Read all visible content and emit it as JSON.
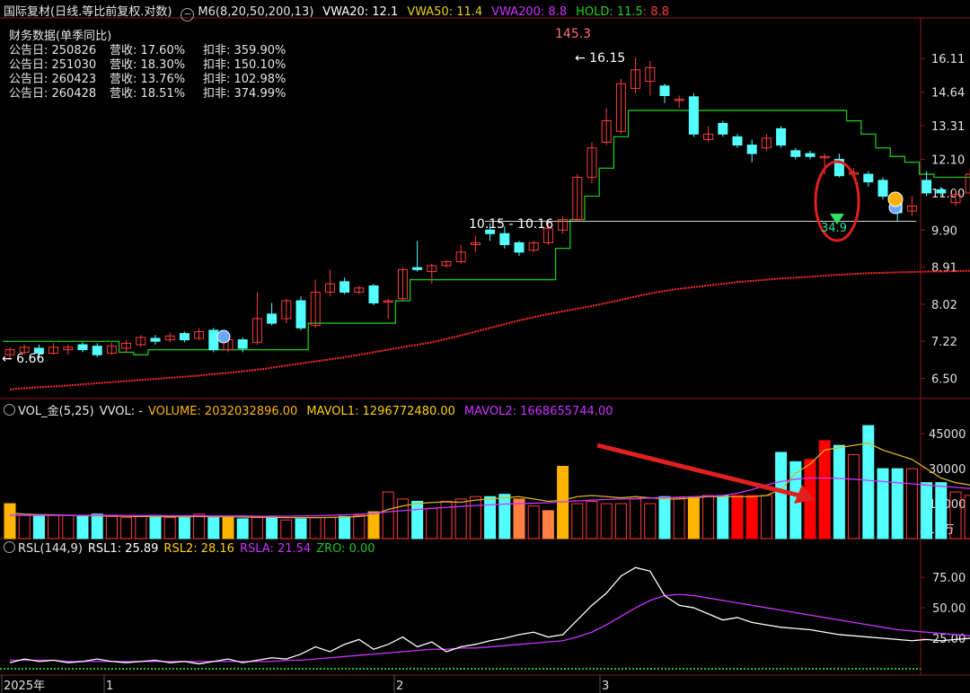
{
  "header": {
    "title": "国际复材(日线.等比前复权.对数)",
    "indicator_icon": "circle-minus-icon",
    "m6": "M6(8,20,50,200,13)",
    "vwa20": "VWA20: 12.1",
    "vwa50": "VWA50: 11.4",
    "vwa200": "VWA200: 8.8",
    "hold": "HOLD: 11.5",
    "hold2": ": 8.8"
  },
  "finance": {
    "title": "财务数据(单季同比)",
    "rows": [
      {
        "date": "公告日: 250826",
        "rev": "营收: 17.60%",
        "profit": "扣非: 359.90%"
      },
      {
        "date": "公告日: 251030",
        "rev": "营收: 18.30%",
        "profit": "扣非: 150.10%"
      },
      {
        "date": "公告日: 260423",
        "rev": "营收: 13.76%",
        "profit": "扣非: 102.98%"
      },
      {
        "date": "公告日: 260428",
        "rev": "营收: 18.51%",
        "profit": "扣非: 374.99%"
      }
    ]
  },
  "vol_header": {
    "name": "VOL_金(5,25)",
    "vvol": "VVOL: -",
    "volume": "VOLUME: 2032032896.00",
    "mavol1": "MAVOL1: 1296772480.00",
    "mavol2": "MAVOL2: 1668655744.00"
  },
  "rsl_header": {
    "name": "RSL(144,9)",
    "rsl1": "RSL1: 25.89",
    "rsl2": "RSL2: 28.16",
    "rsla": "RSLA: 21.54",
    "zro": "ZRO: 0.00"
  },
  "annotations": {
    "peak_count": "145.3",
    "high_label": "16.15",
    "low_label": "6.66",
    "range_label": "10.15 - 10.16",
    "bubble_value": "34.9"
  },
  "colors": {
    "up": "#ff3b3b",
    "down": "#54ffff",
    "hold_line": "#22c322",
    "vwa200": "#ff2a2a",
    "mavol1": "#d9b51f",
    "mavol2": "#cc33ff",
    "rsl1": "#ffffff",
    "rsl2": "#cc33ff",
    "zro": "#22c322",
    "vol_gold": "#ffb400",
    "vol_orange": "#ff8040",
    "vol_red": "#ff0000"
  },
  "chart_data": [
    {
      "type": "candlestick",
      "title": "国际复材(日线.等比前复权.对数)",
      "y_scale": "log",
      "y_ticks": [
        "16.11",
        "14.64",
        "13.31",
        "12.10",
        "11.00",
        "9.90",
        "8.91",
        "8.02",
        "7.22",
        "6.50"
      ],
      "ylim": [
        6.2,
        17.8
      ],
      "x_ticks": [
        "2025年",
        "1",
        "2",
        "3"
      ],
      "candles": [
        [
          6.95,
          7.05,
          6.85,
          7.1
        ],
        [
          7.0,
          7.1,
          6.95,
          7.15
        ],
        [
          7.08,
          6.98,
          6.9,
          7.15
        ],
        [
          6.98,
          7.1,
          6.95,
          7.18
        ],
        [
          7.05,
          7.1,
          6.95,
          7.15
        ],
        [
          7.15,
          7.05,
          7.0,
          7.2
        ],
        [
          7.12,
          6.95,
          6.9,
          7.18
        ],
        [
          6.98,
          7.12,
          6.95,
          7.2
        ],
        [
          7.08,
          7.18,
          7.0,
          7.25
        ],
        [
          7.15,
          7.3,
          7.1,
          7.35
        ],
        [
          7.28,
          7.22,
          7.15,
          7.35
        ],
        [
          7.25,
          7.33,
          7.2,
          7.4
        ],
        [
          7.38,
          7.25,
          7.2,
          7.42
        ],
        [
          7.28,
          7.42,
          7.25,
          7.5
        ],
        [
          7.45,
          7.05,
          7.0,
          7.5
        ],
        [
          7.05,
          7.25,
          7.0,
          7.3
        ],
        [
          7.25,
          7.08,
          7.0,
          7.3
        ],
        [
          7.2,
          7.7,
          7.15,
          8.3
        ],
        [
          7.8,
          7.6,
          7.55,
          8.05
        ],
        [
          7.7,
          8.1,
          7.6,
          8.15
        ],
        [
          8.1,
          7.5,
          7.45,
          8.2
        ],
        [
          7.55,
          8.3,
          7.5,
          8.6
        ],
        [
          8.3,
          8.5,
          8.2,
          8.85
        ],
        [
          8.55,
          8.3,
          8.25,
          8.65
        ],
        [
          8.3,
          8.4,
          8.25,
          8.45
        ],
        [
          8.45,
          8.05,
          8.0,
          8.5
        ],
        [
          8.08,
          8.1,
          7.7,
          8.15
        ],
        [
          8.15,
          8.85,
          8.1,
          8.9
        ],
        [
          8.9,
          8.85,
          8.8,
          9.6
        ],
        [
          8.8,
          8.95,
          8.5,
          9.0
        ],
        [
          8.95,
          9.05,
          8.9,
          9.1
        ],
        [
          9.05,
          9.3,
          9.0,
          9.5
        ],
        [
          9.5,
          9.55,
          9.3,
          9.75
        ],
        [
          9.9,
          9.8,
          9.6,
          10.1
        ],
        [
          9.8,
          9.5,
          9.4,
          10.0
        ],
        [
          9.55,
          9.3,
          9.2,
          9.6
        ],
        [
          9.35,
          9.55,
          9.3,
          9.6
        ],
        [
          9.55,
          9.95,
          9.5,
          10.1
        ],
        [
          9.9,
          10.2,
          9.8,
          10.3
        ],
        [
          10.2,
          11.5,
          10.15,
          11.6
        ],
        [
          11.5,
          12.5,
          11.3,
          12.7
        ],
        [
          12.7,
          13.5,
          12.6,
          14.0
        ],
        [
          13.1,
          15.0,
          13.0,
          15.2
        ],
        [
          14.8,
          15.6,
          14.6,
          16.15
        ],
        [
          15.1,
          15.7,
          14.5,
          16.0
        ],
        [
          14.9,
          14.5,
          14.2,
          15.0
        ],
        [
          14.3,
          14.35,
          14.0,
          14.5
        ],
        [
          14.45,
          13.0,
          12.9,
          14.6
        ],
        [
          12.8,
          13.0,
          12.7,
          13.3
        ],
        [
          13.4,
          13.0,
          12.9,
          13.5
        ],
        [
          12.9,
          12.6,
          12.5,
          13.0
        ],
        [
          12.6,
          12.3,
          12.0,
          12.8
        ],
        [
          12.5,
          12.85,
          12.4,
          13.0
        ],
        [
          13.2,
          12.6,
          12.5,
          13.3
        ],
        [
          12.4,
          12.2,
          12.1,
          12.5
        ],
        [
          12.3,
          12.2,
          12.1,
          12.4
        ],
        [
          12.2,
          12.2,
          11.6,
          12.3
        ],
        [
          12.1,
          11.55,
          11.5,
          12.3
        ],
        [
          11.6,
          11.65,
          11.5,
          11.8
        ],
        [
          11.6,
          11.35,
          11.2,
          11.7
        ],
        [
          11.4,
          10.9,
          10.8,
          11.5
        ],
        [
          10.8,
          10.4,
          10.15,
          10.95
        ],
        [
          10.45,
          10.6,
          10.3,
          10.9
        ],
        [
          11.4,
          11.0,
          10.9,
          11.7
        ],
        [
          11.1,
          11.0,
          10.9,
          11.2
        ],
        [
          10.7,
          10.95,
          10.6,
          11.1
        ],
        [
          11.0,
          11.6,
          10.9,
          11.8
        ]
      ],
      "series": [
        {
          "name": "HOLD",
          "values": [
            7.22,
            7.22,
            7.22,
            7.22,
            7.22,
            7.22,
            7.22,
            7.22,
            7.0,
            6.95,
            7.05,
            7.05,
            7.05,
            7.05,
            7.05,
            7.05,
            7.05,
            7.05,
            7.05,
            7.05,
            7.05,
            7.6,
            7.6,
            7.6,
            7.6,
            7.6,
            7.6,
            8.1,
            8.6,
            8.6,
            8.6,
            8.6,
            8.6,
            8.6,
            8.6,
            8.6,
            8.6,
            8.6,
            9.4,
            10.2,
            10.9,
            11.8,
            12.9,
            13.9,
            13.9,
            13.9,
            13.9,
            13.9,
            13.9,
            13.9,
            13.9,
            13.9,
            13.9,
            13.9,
            13.9,
            13.9,
            13.9,
            13.9,
            13.5,
            13.0,
            12.5,
            12.2,
            12.0,
            11.6,
            11.5,
            11.5,
            11.5
          ]
        },
        {
          "name": "VWA200",
          "values": [
            6.3,
            6.32,
            6.34,
            6.35,
            6.37,
            6.39,
            6.41,
            6.43,
            6.45,
            6.47,
            6.49,
            6.51,
            6.53,
            6.55,
            6.58,
            6.6,
            6.63,
            6.66,
            6.7,
            6.74,
            6.78,
            6.82,
            6.86,
            6.9,
            6.95,
            7.0,
            7.05,
            7.1,
            7.15,
            7.2,
            7.27,
            7.34,
            7.42,
            7.5,
            7.58,
            7.66,
            7.73,
            7.8,
            7.86,
            7.92,
            7.98,
            8.05,
            8.12,
            8.2,
            8.27,
            8.33,
            8.38,
            8.42,
            8.46,
            8.5,
            8.54,
            8.57,
            8.6,
            8.63,
            8.65,
            8.67,
            8.7,
            8.72,
            8.74,
            8.76,
            8.77,
            8.78,
            8.79,
            8.8,
            8.8,
            8.81,
            8.82
          ]
        }
      ]
    },
    {
      "type": "bar",
      "title": "VOL_金(5,25)",
      "unit": "X10万",
      "y_ticks": [
        "45000",
        "30000",
        "15000"
      ],
      "ylim": [
        0,
        52000
      ],
      "values": [
        15000,
        10000,
        10000,
        10000,
        10000,
        9500,
        10500,
        9500,
        9000,
        9500,
        10000,
        9000,
        9000,
        10500,
        9000,
        9500,
        8500,
        9000,
        9500,
        8000,
        8500,
        9000,
        9000,
        9500,
        10000,
        11500,
        20000,
        17000,
        16000,
        13000,
        16000,
        17000,
        18000,
        18000,
        19000,
        17000,
        14000,
        12000,
        31000,
        15000,
        16000,
        15000,
        15000,
        17000,
        15000,
        18000,
        17500,
        17500,
        18500,
        18500,
        18500,
        18500,
        18500,
        37000,
        33000,
        34000,
        42000,
        40000,
        36000,
        48500,
        30000,
        30000,
        30000,
        24000,
        24000,
        20000,
        18500,
        19000,
        24000
      ],
      "series": [
        {
          "name": "MAVOL1",
          "values": [
            11000,
            10500,
            10300,
            10200,
            10000,
            9900,
            9800,
            9700,
            9600,
            9500,
            9500,
            9400,
            9400,
            9500,
            9400,
            9400,
            9300,
            9200,
            9100,
            9000,
            9000,
            9000,
            9100,
            9200,
            9500,
            10200,
            12500,
            14000,
            15000,
            15500,
            15800,
            15600,
            16500,
            17000,
            17500,
            18000,
            17000,
            16000,
            16500,
            18000,
            18500,
            18000,
            17500,
            18000,
            17500,
            17000,
            17000,
            17500,
            18000,
            18000,
            18000,
            18000,
            18500,
            21000,
            28000,
            32000,
            38000,
            39000,
            40000,
            41000,
            38000,
            36000,
            34000,
            30000,
            26000,
            24000,
            23000,
            21000,
            20000,
            19000,
            18000,
            17000,
            16000,
            14000,
            12000,
            11000,
            10000,
            10500,
            11500,
            14000
          ]
        },
        {
          "name": "MAVOL2",
          "values": [
            10000,
            10000,
            10000,
            10000,
            10000,
            10000,
            10000,
            10000,
            9900,
            9900,
            9900,
            9800,
            9800,
            9800,
            9700,
            9700,
            9700,
            9600,
            9600,
            9600,
            9700,
            9800,
            10000,
            10200,
            10500,
            10800,
            11500,
            12000,
            12500,
            13000,
            13400,
            13800,
            14200,
            14500,
            14800,
            15000,
            15200,
            15400,
            15800,
            16200,
            16500,
            16800,
            17000,
            17200,
            17400,
            17600,
            17800,
            18000,
            18200,
            18500,
            19500,
            21000,
            23000,
            24500,
            25500,
            26000,
            26000,
            25800,
            25500,
            25000,
            24500,
            24000,
            23500,
            23000,
            22500,
            22000,
            21500,
            21000,
            20500,
            20000,
            19500,
            19000,
            18500,
            18000,
            17500,
            17000,
            16800,
            16600,
            16600,
            16700
          ]
        }
      ]
    },
    {
      "type": "line",
      "title": "RSL(144,9)",
      "y_ticks": [
        "75.00",
        "50.00",
        "25.00"
      ],
      "ylim": [
        0,
        92
      ],
      "series": [
        {
          "name": "RSL1",
          "values": [
            5,
            8,
            6,
            7,
            5,
            6,
            8,
            6,
            5,
            6,
            7,
            5,
            6,
            4,
            6,
            8,
            5,
            7,
            9,
            8,
            12,
            18,
            14,
            20,
            24,
            16,
            20,
            26,
            18,
            22,
            14,
            18,
            20,
            23,
            25,
            28,
            30,
            26,
            28,
            40,
            52,
            62,
            76,
            83,
            80,
            60,
            52,
            50,
            45,
            40,
            42,
            38,
            36,
            34,
            33,
            32,
            30,
            28,
            27,
            26,
            25,
            24,
            23,
            24,
            23,
            24,
            25,
            26,
            27,
            28,
            27,
            26,
            25,
            24,
            23,
            22,
            21,
            20,
            20,
            21,
            24,
            26
          ]
        },
        {
          "name": "RSL2",
          "values": [
            7,
            7,
            7,
            7,
            6,
            6,
            6,
            6,
            6,
            6,
            6,
            6,
            6,
            6,
            6,
            6,
            6,
            6,
            6,
            7,
            7,
            8,
            9,
            10,
            11,
            12,
            13,
            14,
            15,
            16,
            16,
            17,
            17,
            18,
            19,
            20,
            21,
            22,
            23,
            26,
            30,
            36,
            43,
            50,
            56,
            60,
            61,
            60,
            58,
            56,
            54,
            52,
            50,
            48,
            46,
            44,
            42,
            40,
            38,
            36,
            34,
            32,
            31,
            30,
            29,
            28,
            27,
            26,
            25,
            24,
            24,
            23,
            23,
            22,
            22,
            21,
            21,
            21,
            22,
            22
          ]
        },
        {
          "name": "ZRO",
          "values": [
            0,
            0
          ]
        }
      ]
    }
  ]
}
